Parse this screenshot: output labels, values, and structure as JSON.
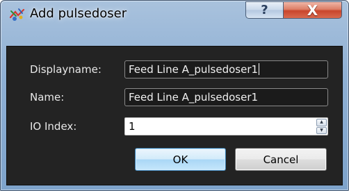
{
  "window": {
    "title": "Add pulsedoser",
    "help_label": "?",
    "close_label": "X",
    "icon": "pulsedoser-app-icon"
  },
  "form": {
    "displayname": {
      "label": "Displayname:",
      "value": "Feed Line A_pulsedoser1"
    },
    "name": {
      "label": "Name:",
      "value": "Feed Line A_pulsedoser1"
    },
    "io_index": {
      "label": "IO Index:",
      "value": "1"
    }
  },
  "buttons": {
    "ok": "OK",
    "cancel": "Cancel"
  },
  "colors": {
    "dialog_background": "#232323",
    "frame": "#8fb0d4",
    "close_button": "#c9452c",
    "ok_accent": "#3c7fb1"
  }
}
